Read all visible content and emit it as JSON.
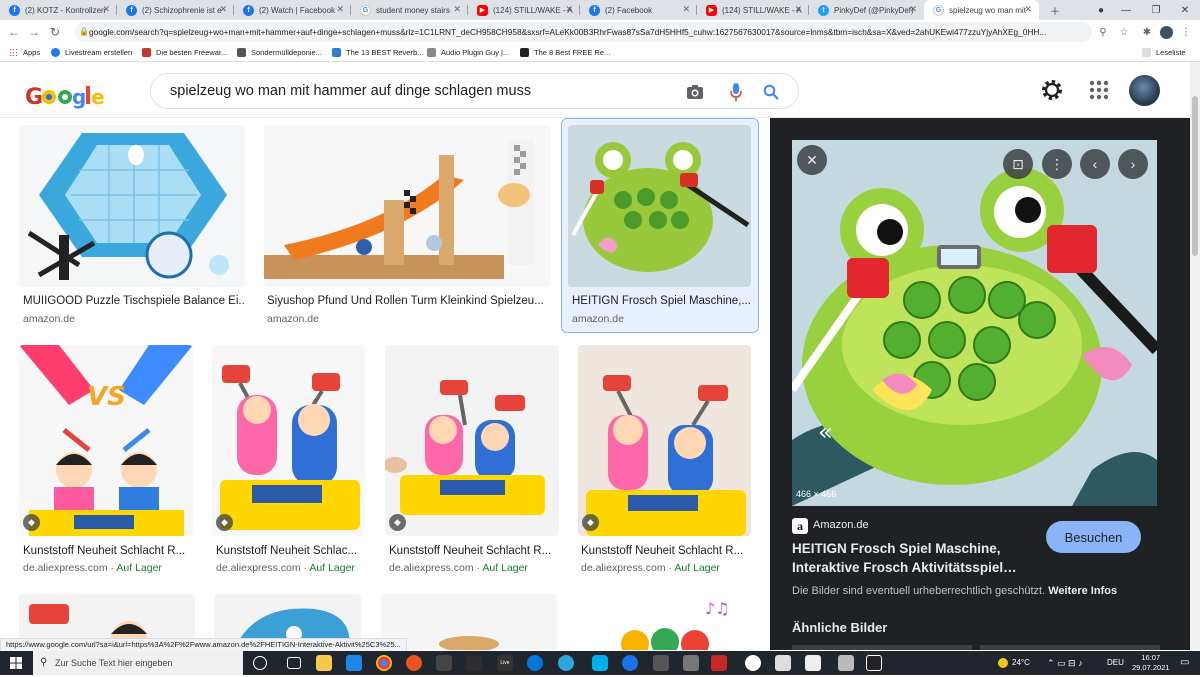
{
  "browser": {
    "tabs": [
      {
        "title": "(2) KOTZ - Kontrollzen",
        "icon": "facebook-icon"
      },
      {
        "title": "(2) Schizophrenie ist e",
        "icon": "facebook-icon"
      },
      {
        "title": "(2) Watch | Facebook",
        "icon": "facebook-icon"
      },
      {
        "title": "student money stairs",
        "icon": "google-icon"
      },
      {
        "title": "(124) STILL/WAKE - A",
        "icon": "youtube-icon"
      },
      {
        "title": "(2) Facebook",
        "icon": "facebook-icon"
      },
      {
        "title": "(124) STILL/WAKE - A",
        "icon": "youtube-icon"
      },
      {
        "title": "PinkyDef (@PinkyDef)",
        "icon": "twitter-icon"
      },
      {
        "title": "spielzeug wo man mit",
        "icon": "google-icon"
      }
    ],
    "url": "google.com/search?q=spielzeug+wo+man+mit+hammer+auf+dinge+schlagen+muss&rlz=1C1LRNT_deCH958CH958&sxsrf=ALeKk00B3RhrFwas87sSa7dH5HHf5_cuhw:1627567630017&source=lnms&tbm=isch&sa=X&ved=2ahUKEwi477zzuYjyAhXEg_0HH...",
    "bookmarks": [
      {
        "label": "Apps"
      },
      {
        "label": "Livestream erstellen"
      },
      {
        "label": "Die besten Freewar..."
      },
      {
        "label": "Sondermülldeponie..."
      },
      {
        "label": "The 13 BEST Reverb..."
      },
      {
        "label": "Audio Plugin Guy |..."
      },
      {
        "label": "The 8 Best FREE Re..."
      }
    ],
    "reading_list": "Leseliste"
  },
  "google": {
    "query": "spielzeug wo man mit hammer auf dinge schlagen muss"
  },
  "results": [
    {
      "caption": "MUIIGOOD Puzzle Tischspiele Balance Ei...",
      "source": "amazon.de",
      "stock": ""
    },
    {
      "caption": "Siyushop Pfund Und Rollen Turm Kleinkind Spielzeu...",
      "source": "amazon.de",
      "stock": ""
    },
    {
      "caption": "HEITIGN Frosch Spiel Maschine,...",
      "source": "amazon.de",
      "stock": ""
    },
    {
      "caption": "Kunststoff Neuheit Schlacht R...",
      "source": "de.aliexpress.com",
      "stock": "Auf Lager"
    },
    {
      "caption": "Kunststoff Neuheit Schlac...",
      "source": "de.aliexpress.com",
      "stock": "Auf Lager"
    },
    {
      "caption": "Kunststoff Neuheit Schlacht R...",
      "source": "de.aliexpress.com",
      "stock": "Auf Lager"
    },
    {
      "caption": "Kunststoff Neuheit Schlacht R...",
      "source": "de.aliexpress.com",
      "stock": "Auf Lager"
    }
  ],
  "stock_separator": "·",
  "preview": {
    "dimensions": "466 × 466",
    "site": "Amazon.de",
    "visit_label": "Besuchen",
    "title_line1": "HEITIGN Frosch Spiel Maschine,",
    "title_line2": "Interaktive Frosch Aktivitätsspiel…",
    "copyright": "Die Bilder sind eventuell urheberrechtlich geschützt.",
    "more_info": "Weitere Infos",
    "similar": "Ähnliche Bilder"
  },
  "status_url": "https://www.google.com/url?sa=i&url=https%3A%2F%2Fwww.amazon.de%2FHEITIGN-Interaktive-Aktivit%25C3%25...",
  "taskbar": {
    "search_placeholder": "Zur Suche Text hier eingeben",
    "weather": "24°C",
    "language": "DEU",
    "time": "16:07",
    "date": "29.07.2021"
  },
  "colors": {
    "accent": "#8ab4f8",
    "panel_bg": "#202124",
    "stock_green": "#188038"
  }
}
